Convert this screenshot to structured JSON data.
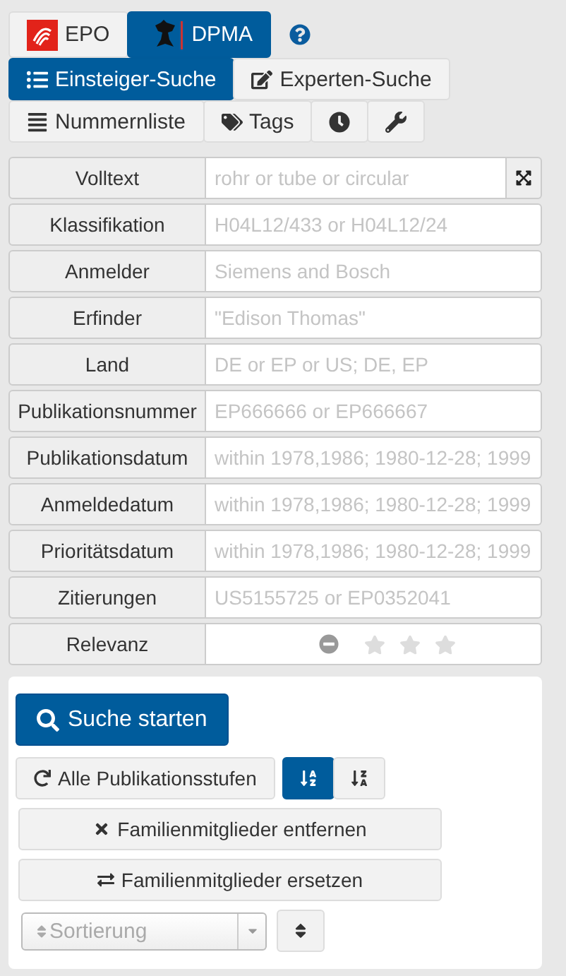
{
  "offices": [
    {
      "label": "EPO",
      "selected": false
    },
    {
      "label": "DPMA",
      "selected": true
    }
  ],
  "modes": [
    {
      "label": "Einsteiger-Suche",
      "selected": true
    },
    {
      "label": "Experten-Suche",
      "selected": false
    }
  ],
  "tools": [
    {
      "kind": "list",
      "label": "Nummernliste"
    },
    {
      "kind": "tags",
      "label": "Tags"
    },
    {
      "kind": "history"
    },
    {
      "kind": "settings"
    }
  ],
  "fields": [
    {
      "label": "Volltext",
      "placeholder": "rohr or tube or circular",
      "kind": "expandable"
    },
    {
      "label": "Klassifikation",
      "placeholder": "H04L12/433 or H04L12/24",
      "kind": "text"
    },
    {
      "label": "Anmelder",
      "placeholder": "Siemens and Bosch",
      "kind": "text"
    },
    {
      "label": "Erfinder",
      "placeholder": "\"Edison Thomas\"",
      "kind": "text"
    },
    {
      "label": "Land",
      "placeholder": "DE or EP or US; DE, EP",
      "kind": "text"
    },
    {
      "label": "Publikationsnummer",
      "placeholder": "EP666666 or EP666667",
      "kind": "text"
    },
    {
      "label": "Publikationsdatum",
      "placeholder": "within 1978,1986; 1980-12-28; 1999",
      "kind": "text"
    },
    {
      "label": "Anmeldedatum",
      "placeholder": "within 1978,1986; 1980-12-28; 1999",
      "kind": "text"
    },
    {
      "label": "Prioritätsdatum",
      "placeholder": "within 1978,1986; 1980-12-28; 1999",
      "kind": "text"
    },
    {
      "label": "Zitierungen",
      "placeholder": "US5155725 or EP0352041",
      "kind": "text"
    }
  ],
  "relevance": {
    "label": "Relevanz",
    "stars": 0
  },
  "search_button": "Suche starten",
  "stages_button": "Alle Publikationsstufen",
  "sort_order": [
    {
      "kind": "ascending",
      "selected": true
    },
    {
      "kind": "descending",
      "selected": false
    }
  ],
  "family_remove": "Familienmitglieder entfernen",
  "family_replace": "Familienmitglieder ersetzen",
  "sorting": {
    "placeholder": "Sortierung"
  }
}
